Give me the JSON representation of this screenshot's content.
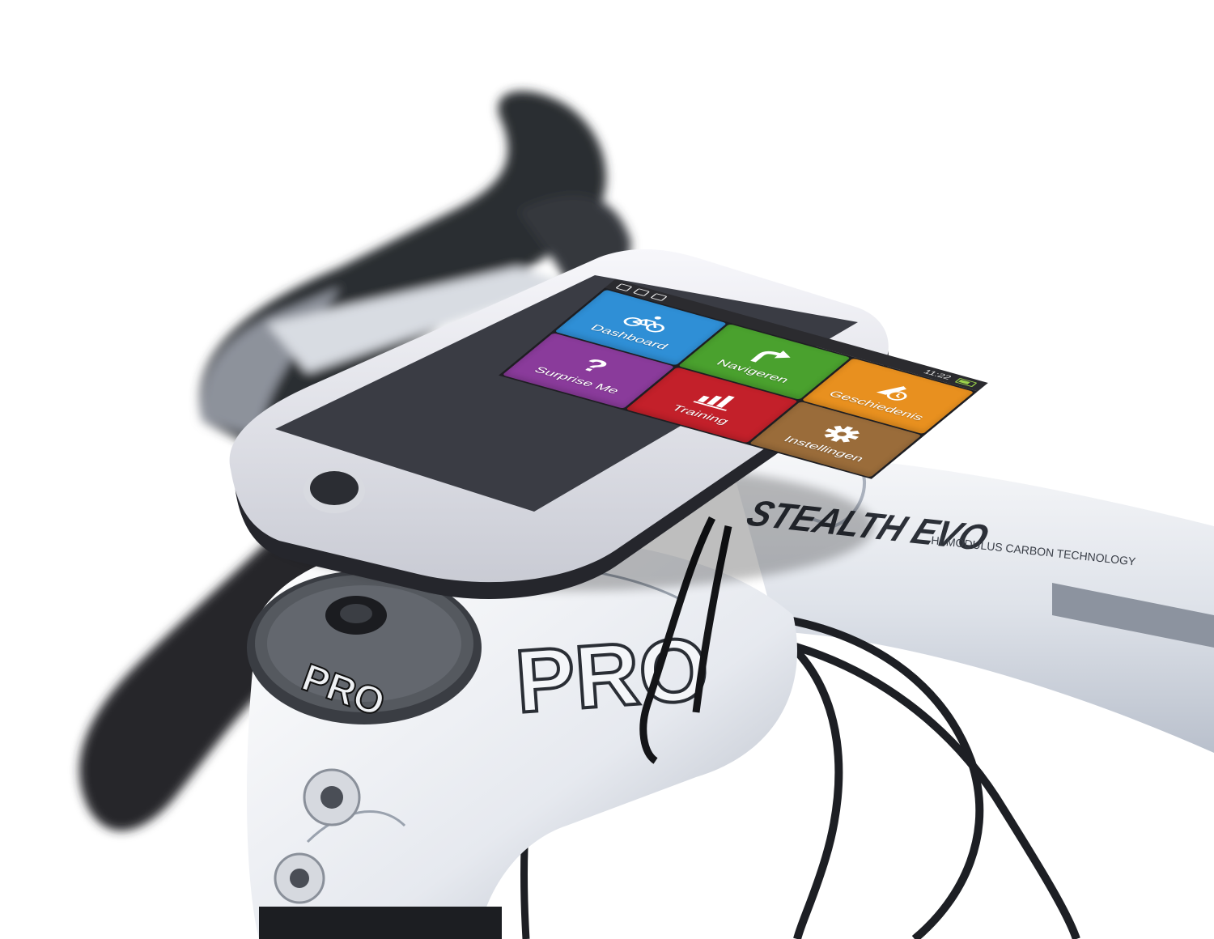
{
  "statusbar": {
    "time": "11:22"
  },
  "tiles": [
    {
      "label": "Dashboard",
      "color": "#2f8fd6",
      "icon": "bicycle-icon"
    },
    {
      "label": "Geschiedenis",
      "color": "#e8901f",
      "icon": "history-icon"
    },
    {
      "label": "Training",
      "color": "#c3202a",
      "icon": "bar-chart-icon"
    },
    {
      "label": "Navigeren",
      "color": "#4aa12e",
      "icon": "turn-arrow-icon"
    },
    {
      "label": "Surprise Me",
      "color": "#8a3b9b",
      "icon": "question-icon"
    },
    {
      "label": "Instellingen",
      "color": "#9a6c3a",
      "icon": "gear-icon"
    }
  ],
  "printed_text": {
    "stem_brand": "PRO",
    "cap_brand": "PRO",
    "bar_brand": "STEALTH EVO",
    "bar_subtext": "HI-MODULUS CARBON TECHNOLOGY"
  }
}
